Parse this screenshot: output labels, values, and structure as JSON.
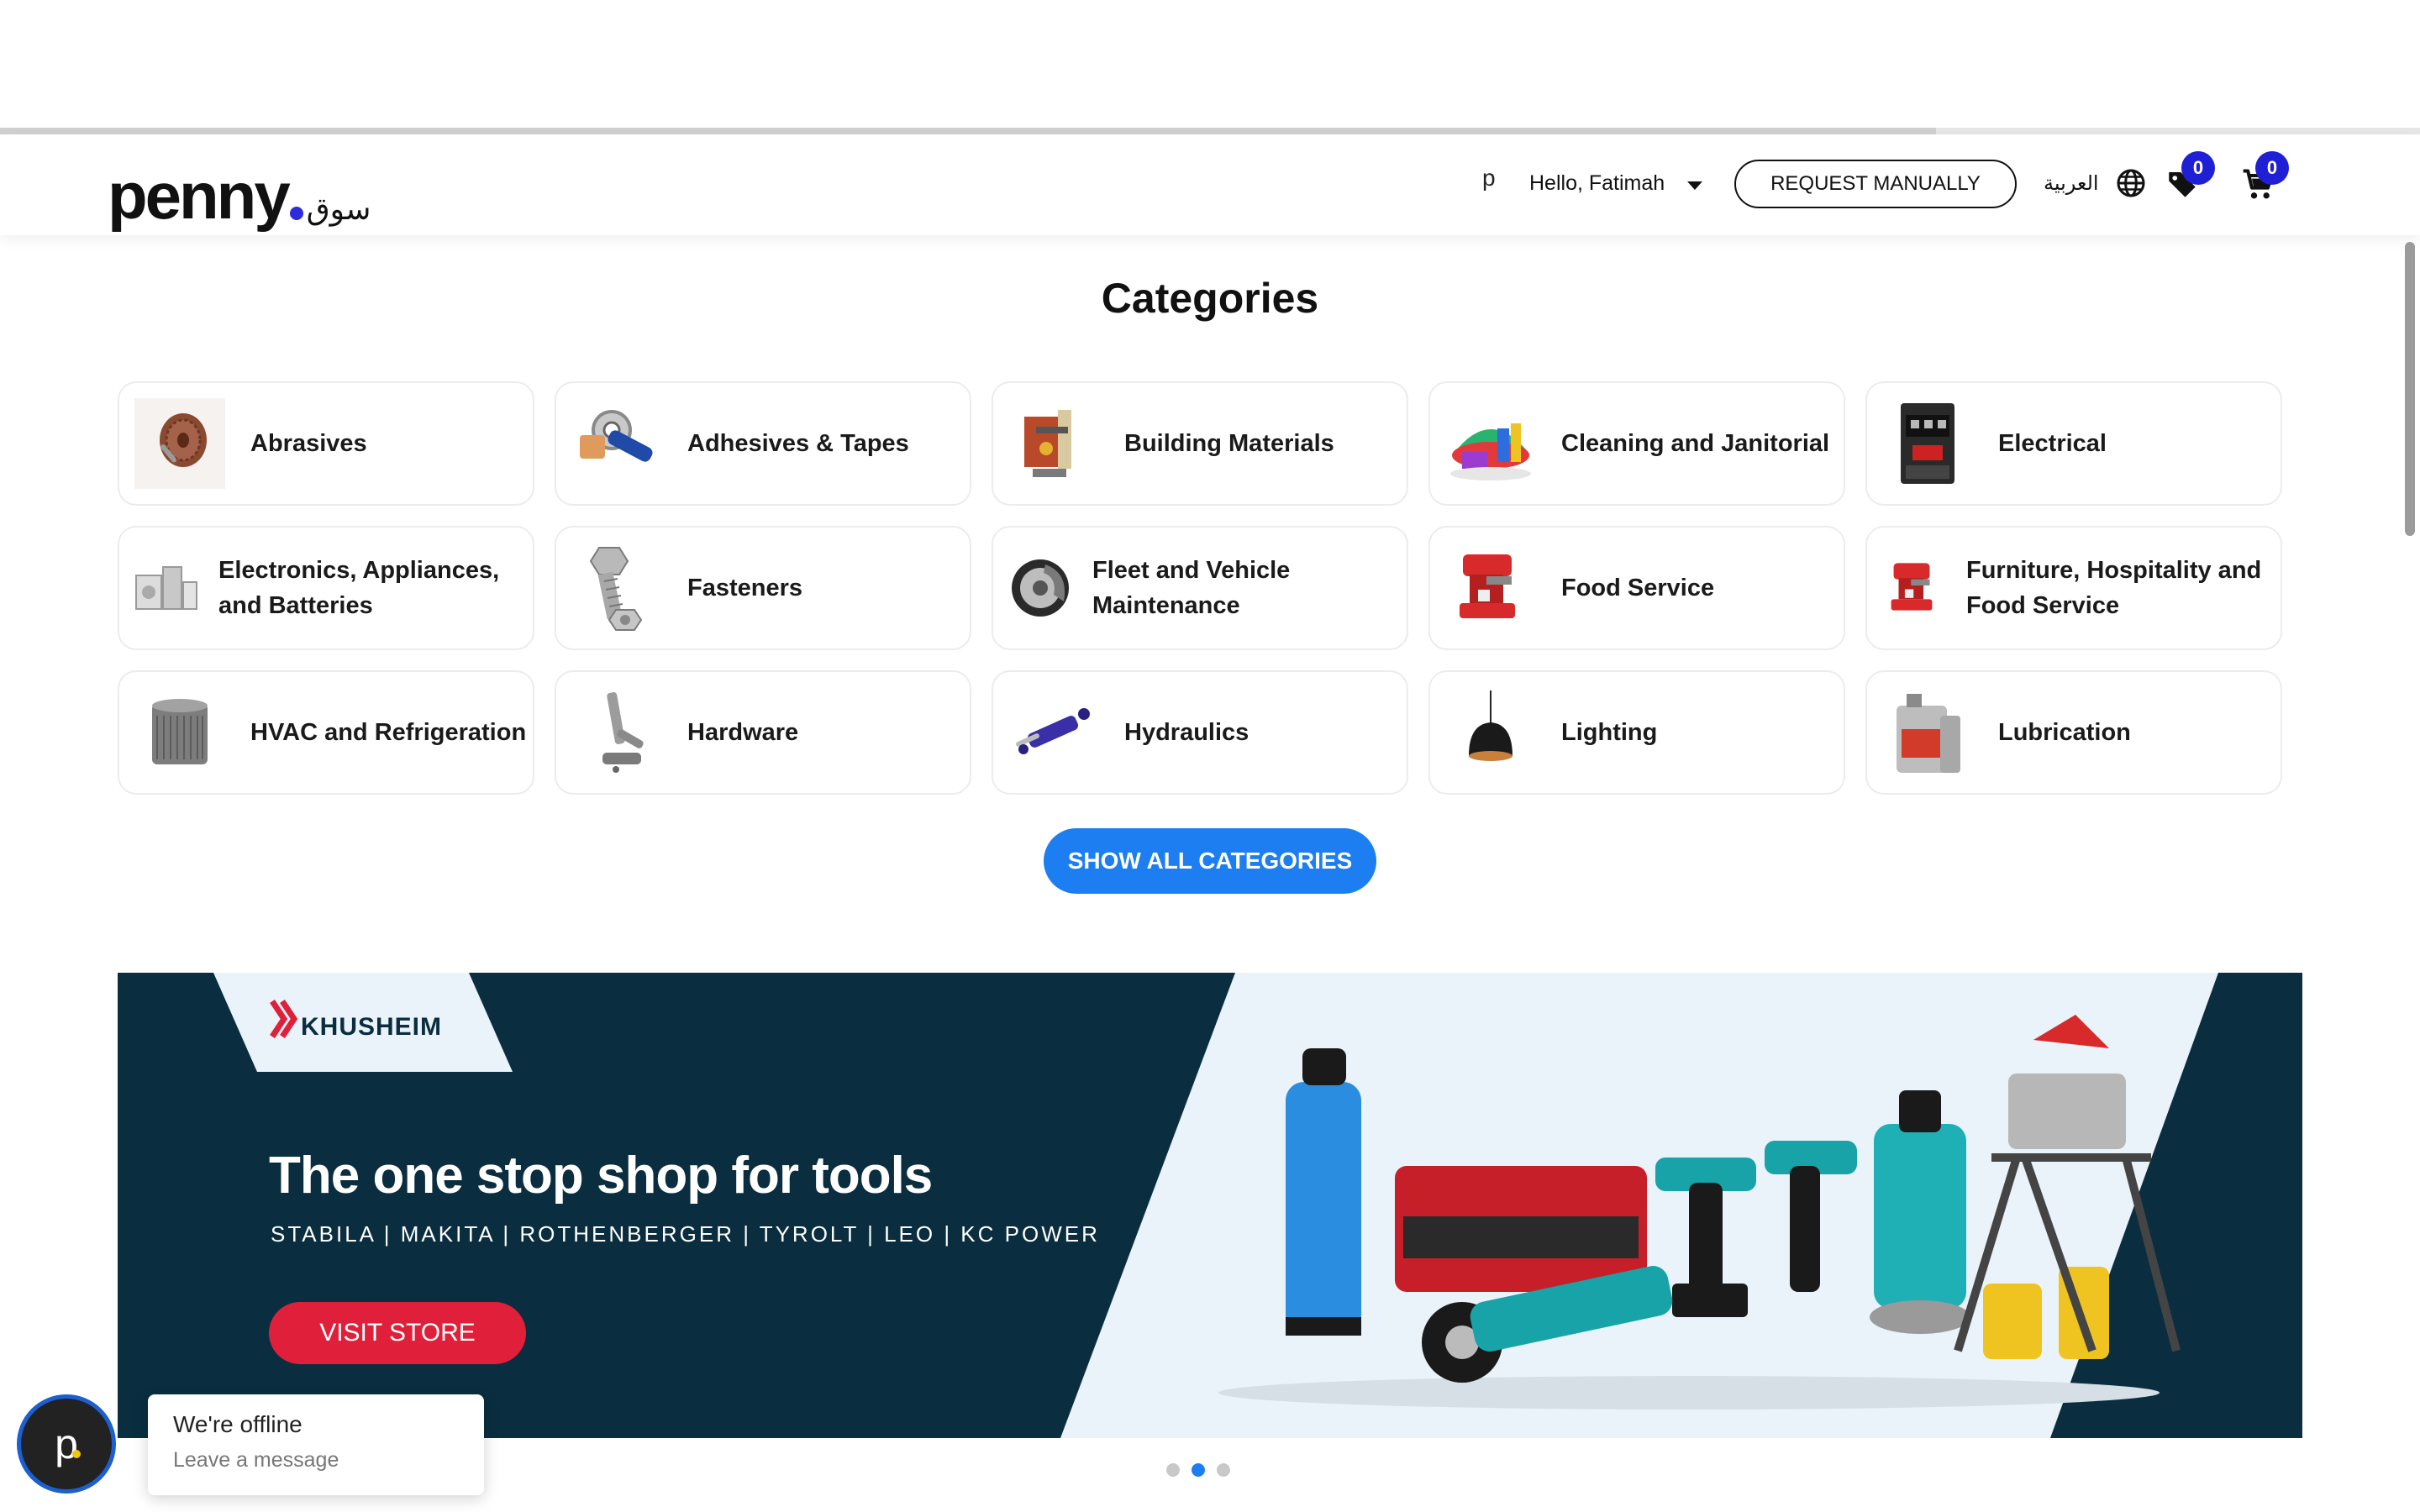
{
  "header": {
    "logo_text": "penny",
    "logo_arabic": "سوق",
    "user_initial": "p",
    "greeting": "Hello, Fatimah",
    "request_button": "REQUEST MANUALLY",
    "language": "العربية",
    "wishlist_count": "0",
    "cart_count": "0"
  },
  "categories": {
    "title": "Categories",
    "items": [
      {
        "label": "Abrasives"
      },
      {
        "label": "Adhesives & Tapes"
      },
      {
        "label": "Building Materials"
      },
      {
        "label": "Cleaning and Janitorial"
      },
      {
        "label": "Electrical"
      },
      {
        "label": "Electronics, Appliances, and Batteries"
      },
      {
        "label": "Fasteners"
      },
      {
        "label": "Fleet and Vehicle Maintenance"
      },
      {
        "label": "Food Service"
      },
      {
        "label": "Furniture, Hospitality and Food Service"
      },
      {
        "label": "HVAC and Refrigeration"
      },
      {
        "label": "Hardware"
      },
      {
        "label": "Hydraulics"
      },
      {
        "label": "Lighting"
      },
      {
        "label": "Lubrication"
      }
    ],
    "show_all": "SHOW ALL CATEGORIES"
  },
  "banner": {
    "brand": "KHUSHEIM",
    "title": "The one stop shop for tools",
    "brands_line": "STABILA | MAKITA | ROTHENBERGER | TYROLT | LEO | KC POWER",
    "cta": "VISIT STORE"
  },
  "chat": {
    "avatar_letter": "p",
    "status": "We're offline",
    "prompt": "Leave a message"
  },
  "colors": {
    "accent_blue": "#1c7ef0",
    "badge_blue": "#1f1fd6",
    "banner_navy": "#0a2e3f",
    "cta_red": "#e0203a"
  }
}
